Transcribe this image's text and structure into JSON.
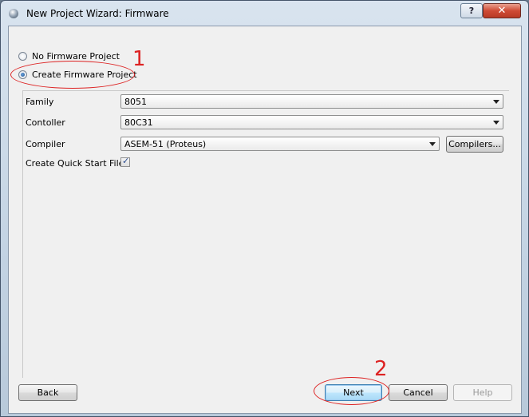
{
  "window": {
    "title": "New Project Wizard: Firmware",
    "help_glyph": "?",
    "close_glyph": "✕"
  },
  "radios": [
    {
      "label": "No Firmware Project",
      "checked": false
    },
    {
      "label": "Create Firmware Project",
      "checked": true
    }
  ],
  "form": {
    "family": {
      "label": "Family",
      "value": "8051"
    },
    "controller": {
      "label": "Contoller",
      "value": "80C31"
    },
    "compiler": {
      "label": "Compiler",
      "value": "ASEM-51 (Proteus)"
    },
    "compilers_button": "Compilers...",
    "quick_start": {
      "label": "Create Quick Start Files",
      "checked": true
    }
  },
  "buttons": {
    "back": "Back",
    "next": "Next",
    "cancel": "Cancel",
    "help": "Help"
  },
  "annotations": {
    "one": "1",
    "two": "2",
    "color": "#dd2222"
  }
}
